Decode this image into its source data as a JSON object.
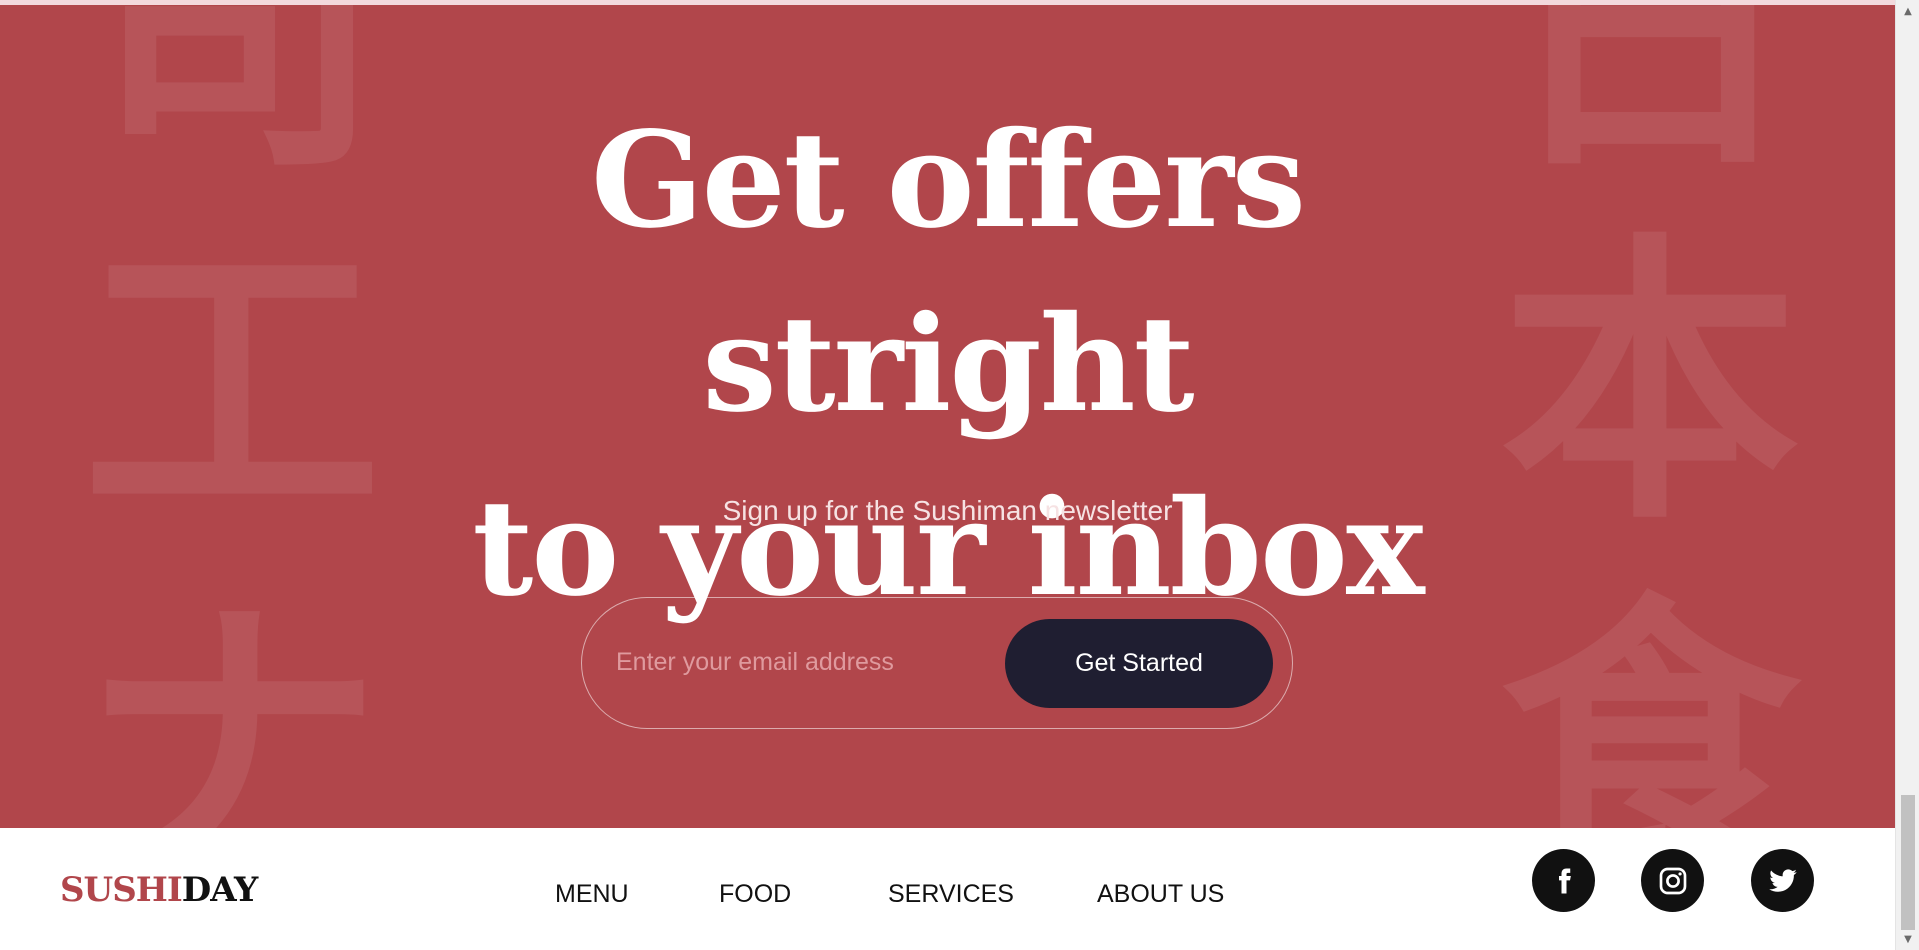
{
  "hero": {
    "headline_line1": "Get offers stright",
    "headline_line2": "to your inbox",
    "subtitle": "Sign up for the Sushiman newsletter",
    "background_color": "#b1464b",
    "decor_left": [
      "司",
      "工",
      "ナ"
    ],
    "decor_right": [
      "日",
      "本",
      "食"
    ]
  },
  "signup": {
    "email_placeholder": "Enter your email address",
    "email_value": "",
    "button_label": "Get Started",
    "button_color": "#1f1e31"
  },
  "footer": {
    "logo_part1": "SUSHI",
    "logo_part2": "DAY",
    "nav": [
      "MENU",
      "FOOD",
      "SERVICES",
      "ABOUT US"
    ],
    "social": [
      "facebook-icon",
      "instagram-icon",
      "twitter-icon"
    ]
  },
  "scrollbar": {
    "up_arrow": "▲",
    "down_arrow": "▼"
  }
}
